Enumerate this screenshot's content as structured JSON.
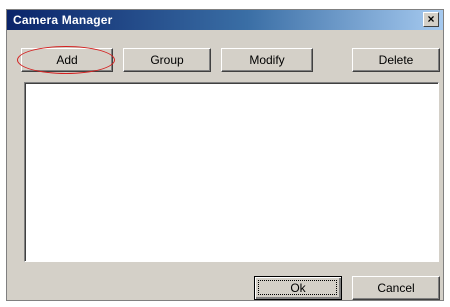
{
  "window": {
    "title": "Camera Manager",
    "close_symbol": "×"
  },
  "toolbar": {
    "add_label": "Add",
    "group_label": "Group",
    "modify_label": "Modify",
    "delete_label": "Delete"
  },
  "footer": {
    "ok_label": "Ok",
    "cancel_label": "Cancel"
  },
  "annotation": {
    "highlight_color": "#d42020"
  },
  "camera_list": {
    "items": []
  }
}
